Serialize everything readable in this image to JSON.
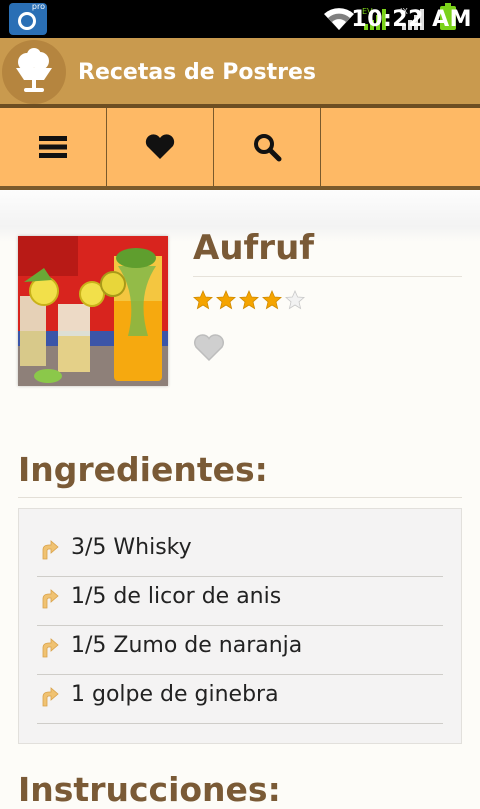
{
  "status_bar": {
    "camera_badge": "pro",
    "signal_1_label": "EV",
    "signal_2_label": "IX",
    "time": "10:22 AM"
  },
  "action_bar": {
    "title": "Recetas de Postres",
    "logo_icon": "ice-cream-cup-icon"
  },
  "toolbar": {
    "buttons": [
      {
        "icon": "menu-icon"
      },
      {
        "icon": "heart-icon"
      },
      {
        "icon": "search-icon"
      }
    ]
  },
  "recipe": {
    "title": "Aufruf",
    "rating": 4,
    "rating_max": 5,
    "favorite_icon": "heart-outline-icon"
  },
  "ingredients": {
    "heading": "Ingredientes:",
    "items": [
      "3/5 Whisky",
      "1/5 de licor de anis",
      "1/5 Zumo de naranja",
      "1 golpe de ginebra"
    ]
  },
  "instructions": {
    "heading": "Instrucciones:"
  },
  "colors": {
    "action_bar": "#c99a4e",
    "toolbar": "#feb965",
    "heading_text": "#7a5a36",
    "star": "#f5a400"
  }
}
